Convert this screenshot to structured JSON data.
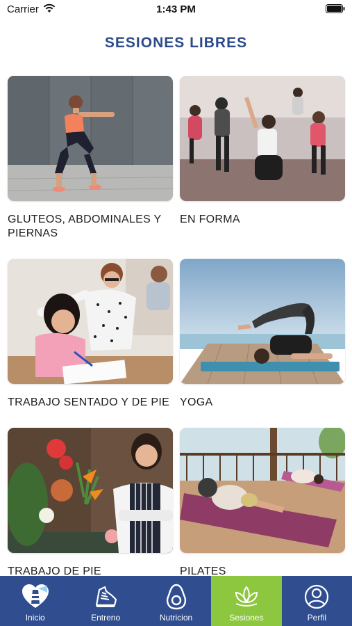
{
  "status_bar": {
    "carrier": "Carrier",
    "time": "1:43 PM"
  },
  "page": {
    "title": "SESIONES LIBRES"
  },
  "sessions": [
    {
      "label": "GLUTEOS, ABDOMINALES Y PIERNAS",
      "image": "squat-woman-photo"
    },
    {
      "label": "EN FORMA",
      "image": "dance-class-photo"
    },
    {
      "label": "TRABAJO SENTADO Y DE PIE",
      "image": "teacher-student-photo"
    },
    {
      "label": "YOGA",
      "image": "yoga-pose-photo"
    },
    {
      "label": "TRABAJO DE PIE",
      "image": "florist-photo"
    },
    {
      "label": "PILATES",
      "image": "pilates-mat-photo"
    }
  ],
  "tabbar": {
    "active_color": "#8dc63f",
    "background": "#2f4d8f",
    "items": [
      {
        "label": "Inicio",
        "icon": "heart-lighthouse-icon"
      },
      {
        "label": "Entreno",
        "icon": "sneaker-icon"
      },
      {
        "label": "Nutricion",
        "icon": "avocado-icon"
      },
      {
        "label": "Sesiones",
        "icon": "lotus-icon",
        "active": true
      },
      {
        "label": "Perfil",
        "icon": "user-icon"
      }
    ]
  }
}
